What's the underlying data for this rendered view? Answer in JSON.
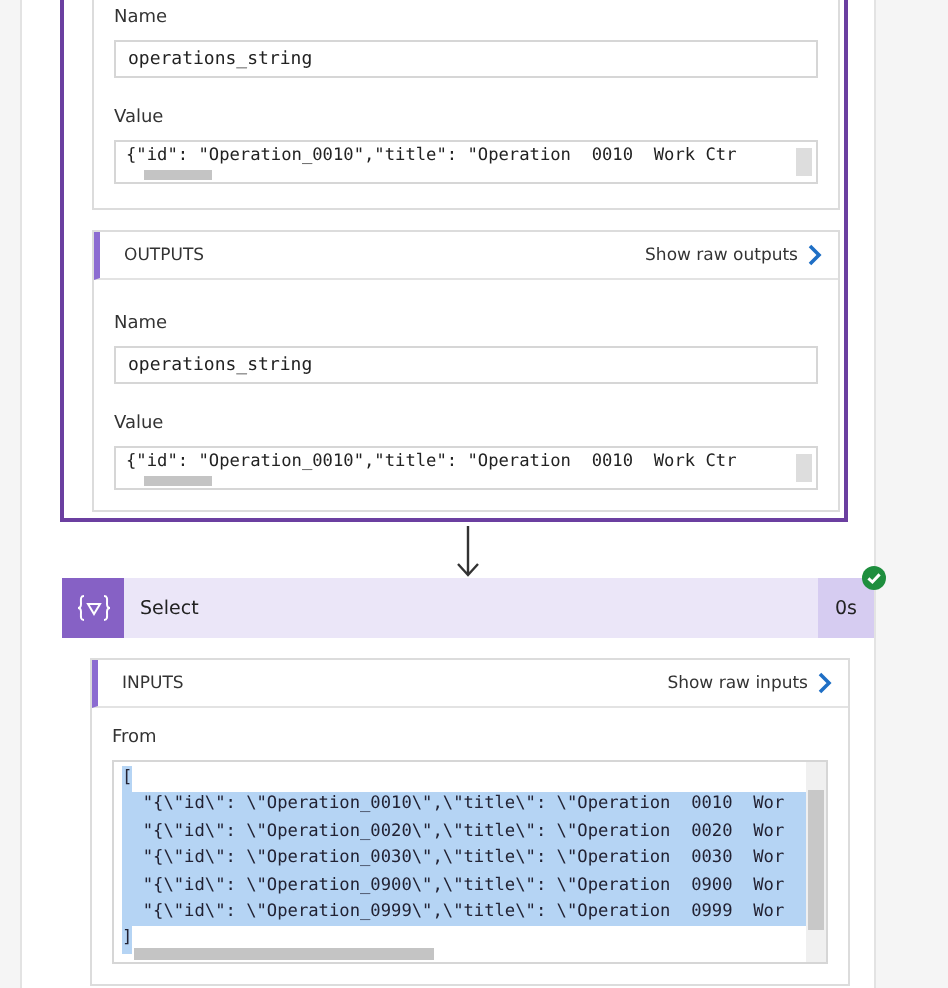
{
  "top_card": {
    "inputs_section": {
      "fields": [
        {
          "label": "Name",
          "value": "operations_string",
          "kind": "single"
        },
        {
          "label": "Value",
          "value": "{\"id\": \"Operation_0010\",\"title\": \"Operation  0010  Work Ctr",
          "kind": "scroll"
        }
      ]
    },
    "outputs_section": {
      "title": "OUTPUTS",
      "link": "Show raw outputs",
      "fields": [
        {
          "label": "Name",
          "value": "operations_string",
          "kind": "single"
        },
        {
          "label": "Value",
          "value": "{\"id\": \"Operation_0010\",\"title\": \"Operation  0010  Work Ctr",
          "kind": "scroll"
        }
      ]
    }
  },
  "select_card": {
    "title": "Select",
    "duration": "0s",
    "succeeded": true,
    "inputs_section": {
      "title": "INPUTS",
      "link": "Show raw inputs",
      "from": {
        "label": "From",
        "text_selected": true,
        "lines": [
          "[",
          "  \"{\\\"id\\\": \\\"Operation_0010\\\",\\\"title\\\": \\\"Operation  0010  Wor",
          "  \"{\\\"id\\\": \\\"Operation_0020\\\",\\\"title\\\": \\\"Operation  0020  Wor",
          "  \"{\\\"id\\\": \\\"Operation_0030\\\",\\\"title\\\": \\\"Operation  0030  Wor",
          "  \"{\\\"id\\\": \\\"Operation_0900\\\",\\\"title\\\": \\\"Operation  0900  Wor",
          "  \"{\\\"id\\\": \\\"Operation_0999\\\",\\\"title\\\": \\\"Operation  0999  Wor",
          "]"
        ]
      }
    }
  }
}
